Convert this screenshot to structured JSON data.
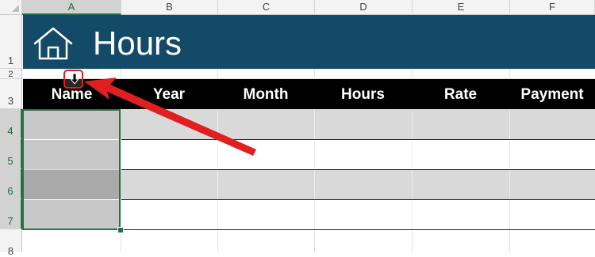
{
  "sheet": {
    "columns": [
      "A",
      "B",
      "C",
      "D",
      "E",
      "F"
    ],
    "rows": [
      "1",
      "2",
      "3",
      "4",
      "5",
      "6",
      "7",
      "8"
    ],
    "selected_column": "A",
    "selected_rows": [
      "4",
      "5",
      "6",
      "7"
    ]
  },
  "banner": {
    "title": "Hours",
    "icon": "home-icon",
    "color": "#134a68"
  },
  "table": {
    "headers": [
      "Name",
      "Year",
      "Month",
      "Hours",
      "Rate",
      "Payment"
    ],
    "header_bg": "#000000",
    "band_color": "#d9d9d9"
  },
  "annotation": {
    "color": "#e02020",
    "cursor_icon": "select-down-arrow-icon"
  }
}
